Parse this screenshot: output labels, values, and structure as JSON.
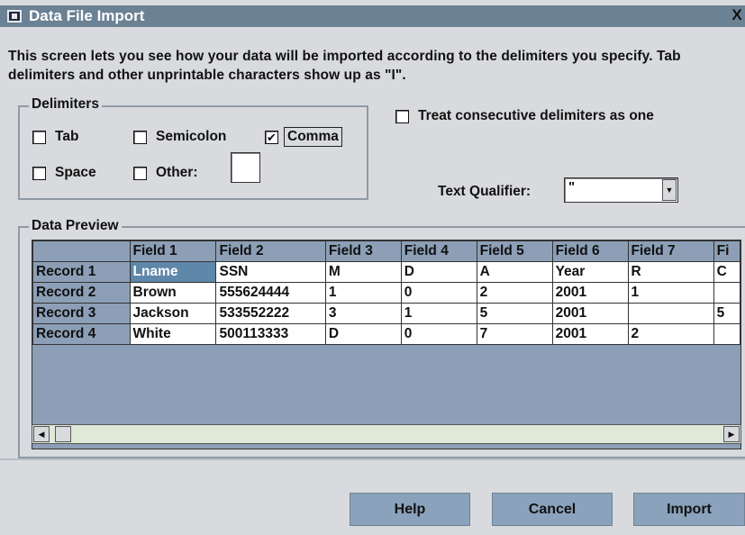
{
  "window": {
    "title": "Data File Import",
    "close_glyph": "X"
  },
  "intro_text": "This screen lets you see how your data will be imported according to the delimiters you specify.  Tab delimiters and other unprintable characters show up as \"I\".",
  "delimiters": {
    "group_label": "Delimiters",
    "tab": {
      "label": "Tab",
      "checked": false
    },
    "semicolon": {
      "label": "Semicolon",
      "checked": false
    },
    "comma": {
      "label": "Comma",
      "checked": true
    },
    "space": {
      "label": "Space",
      "checked": false
    },
    "other": {
      "label": "Other:",
      "checked": false,
      "value": ""
    }
  },
  "consecutive": {
    "label": "Treat consecutive delimiters as one",
    "checked": false
  },
  "qualifier": {
    "label": "Text Qualifier:",
    "value": "\""
  },
  "preview": {
    "group_label": "Data Preview",
    "columns": [
      "Field 1",
      "Field 2",
      "Field 3",
      "Field 4",
      "Field 5",
      "Field 6",
      "Field 7",
      "Fi"
    ],
    "rows": [
      {
        "label": "Record 1",
        "cells": [
          "Lname",
          "SSN",
          "M",
          "D",
          "A",
          "Year",
          "R",
          "C"
        ]
      },
      {
        "label": "Record 2",
        "cells": [
          "Brown",
          "555624444",
          "1",
          "0",
          "2",
          "2001",
          "1",
          ""
        ]
      },
      {
        "label": "Record 3",
        "cells": [
          "Jackson",
          "533552222",
          "3",
          "1",
          "5",
          "2001",
          "",
          "5"
        ]
      },
      {
        "label": "Record 4",
        "cells": [
          "White",
          "500113333",
          "D",
          "0",
          "7",
          "2001",
          "2",
          ""
        ]
      }
    ]
  },
  "buttons": {
    "help": "Help",
    "cancel": "Cancel",
    "import": "Import"
  },
  "colors": {
    "title_bar": "#6b8194",
    "grid_header": "#8c9fb6",
    "selected_cell": "#5e87a9",
    "button": "#8aa2bb"
  }
}
